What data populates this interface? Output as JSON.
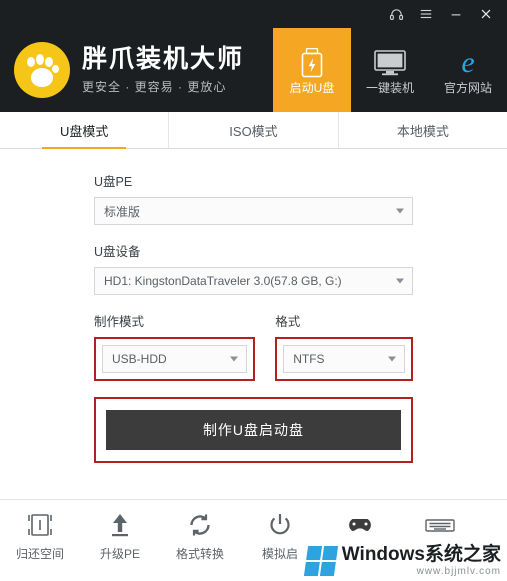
{
  "window": {
    "controls": [
      {
        "name": "headset-icon",
        "glyph": "headset"
      },
      {
        "name": "menu-icon",
        "glyph": "menu"
      },
      {
        "name": "minimize-icon",
        "glyph": "minimize"
      },
      {
        "name": "close-icon",
        "glyph": "close"
      }
    ]
  },
  "header": {
    "brand_title": "胖爪装机大师",
    "brand_sub": "更安全 · 更容易 · 更放心",
    "nav": [
      {
        "label": "启动U盘",
        "icon": "usb-icon",
        "active": true
      },
      {
        "label": "一键装机",
        "icon": "monitor-icon",
        "active": false
      },
      {
        "label": "官方网站",
        "icon": "ie-icon",
        "active": false
      }
    ]
  },
  "tabs": [
    {
      "label": "U盘模式",
      "active": true
    },
    {
      "label": "ISO模式",
      "active": false
    },
    {
      "label": "本地模式",
      "active": false
    }
  ],
  "form": {
    "pe_label": "U盘PE",
    "pe_value": "标准版",
    "device_label": "U盘设备",
    "device_value": "HD1: KingstonDataTraveler 3.0(57.8 GB, G:)",
    "mode_label": "制作模式",
    "mode_value": "USB-HDD",
    "format_label": "格式",
    "format_value": "NTFS",
    "make_button": "制作U盘启动盘"
  },
  "bottom": [
    {
      "label": "归还空间",
      "icon": "restore-space-icon"
    },
    {
      "label": "升级PE",
      "icon": "upgrade-pe-icon"
    },
    {
      "label": "格式转换",
      "icon": "format-convert-icon"
    },
    {
      "label": "模拟启",
      "icon": "simulate-boot-icon"
    },
    {
      "label": "",
      "icon": "game-controller-icon"
    },
    {
      "label": "",
      "icon": "keyboard-icon"
    }
  ],
  "watermark": {
    "main": "Windows系统之家",
    "sub": "www.bjjmlv.com"
  },
  "colors": {
    "accent": "#f5a623",
    "dark": "#1b1f22",
    "highlight_box": "#b22020",
    "button": "#3c3c3c",
    "logo_yellow": "#f5c518"
  }
}
